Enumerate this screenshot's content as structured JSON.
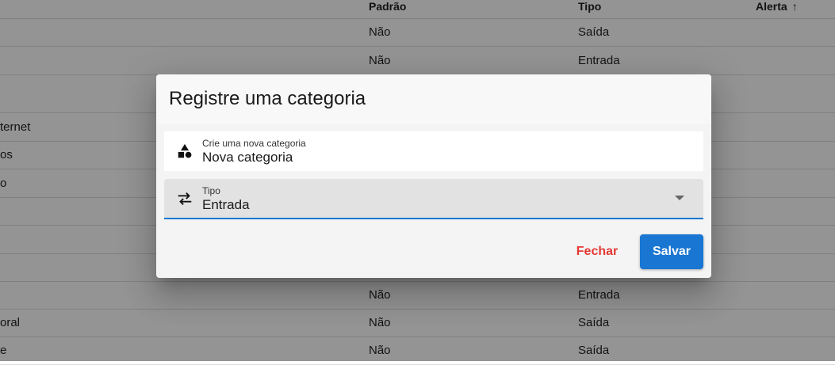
{
  "table": {
    "headers": {
      "padrao": "Padrão",
      "tipo": "Tipo",
      "alerta": "Alerta",
      "alerta_sort": "↑"
    },
    "rows": [
      {
        "name": "",
        "padrao": "Não",
        "tipo": "Saída"
      },
      {
        "name": "",
        "padrao": "Não",
        "tipo": "Entrada"
      },
      {
        "name": "",
        "padrao": "",
        "tipo": ""
      },
      {
        "name": "ternet",
        "padrao": "",
        "tipo": ""
      },
      {
        "name": "os",
        "padrao": "",
        "tipo": ""
      },
      {
        "name": "o",
        "padrao": "",
        "tipo": ""
      },
      {
        "name": "",
        "padrao": "",
        "tipo": ""
      },
      {
        "name": "",
        "padrao": "",
        "tipo": ""
      },
      {
        "name": "",
        "padrao": "",
        "tipo": ""
      },
      {
        "name": "",
        "padrao": "Não",
        "tipo": "Entrada"
      },
      {
        "name": "oral",
        "padrao": "Não",
        "tipo": "Saída"
      },
      {
        "name": "e",
        "padrao": "Não",
        "tipo": "Saída"
      }
    ]
  },
  "dialog": {
    "title": "Registre uma categoria",
    "name_field": {
      "label": "Crie uma nova categoria",
      "value": "Nova categoria",
      "icon": "shapes-icon"
    },
    "type_field": {
      "label": "Tipo",
      "value": "Entrada",
      "icon": "swap-horizontal-icon"
    },
    "close_label": "Fechar",
    "save_label": "Salvar"
  },
  "colors": {
    "primary": "#1976d2",
    "danger": "#e53935",
    "overlay": "rgba(0,0,0,0.42)"
  }
}
